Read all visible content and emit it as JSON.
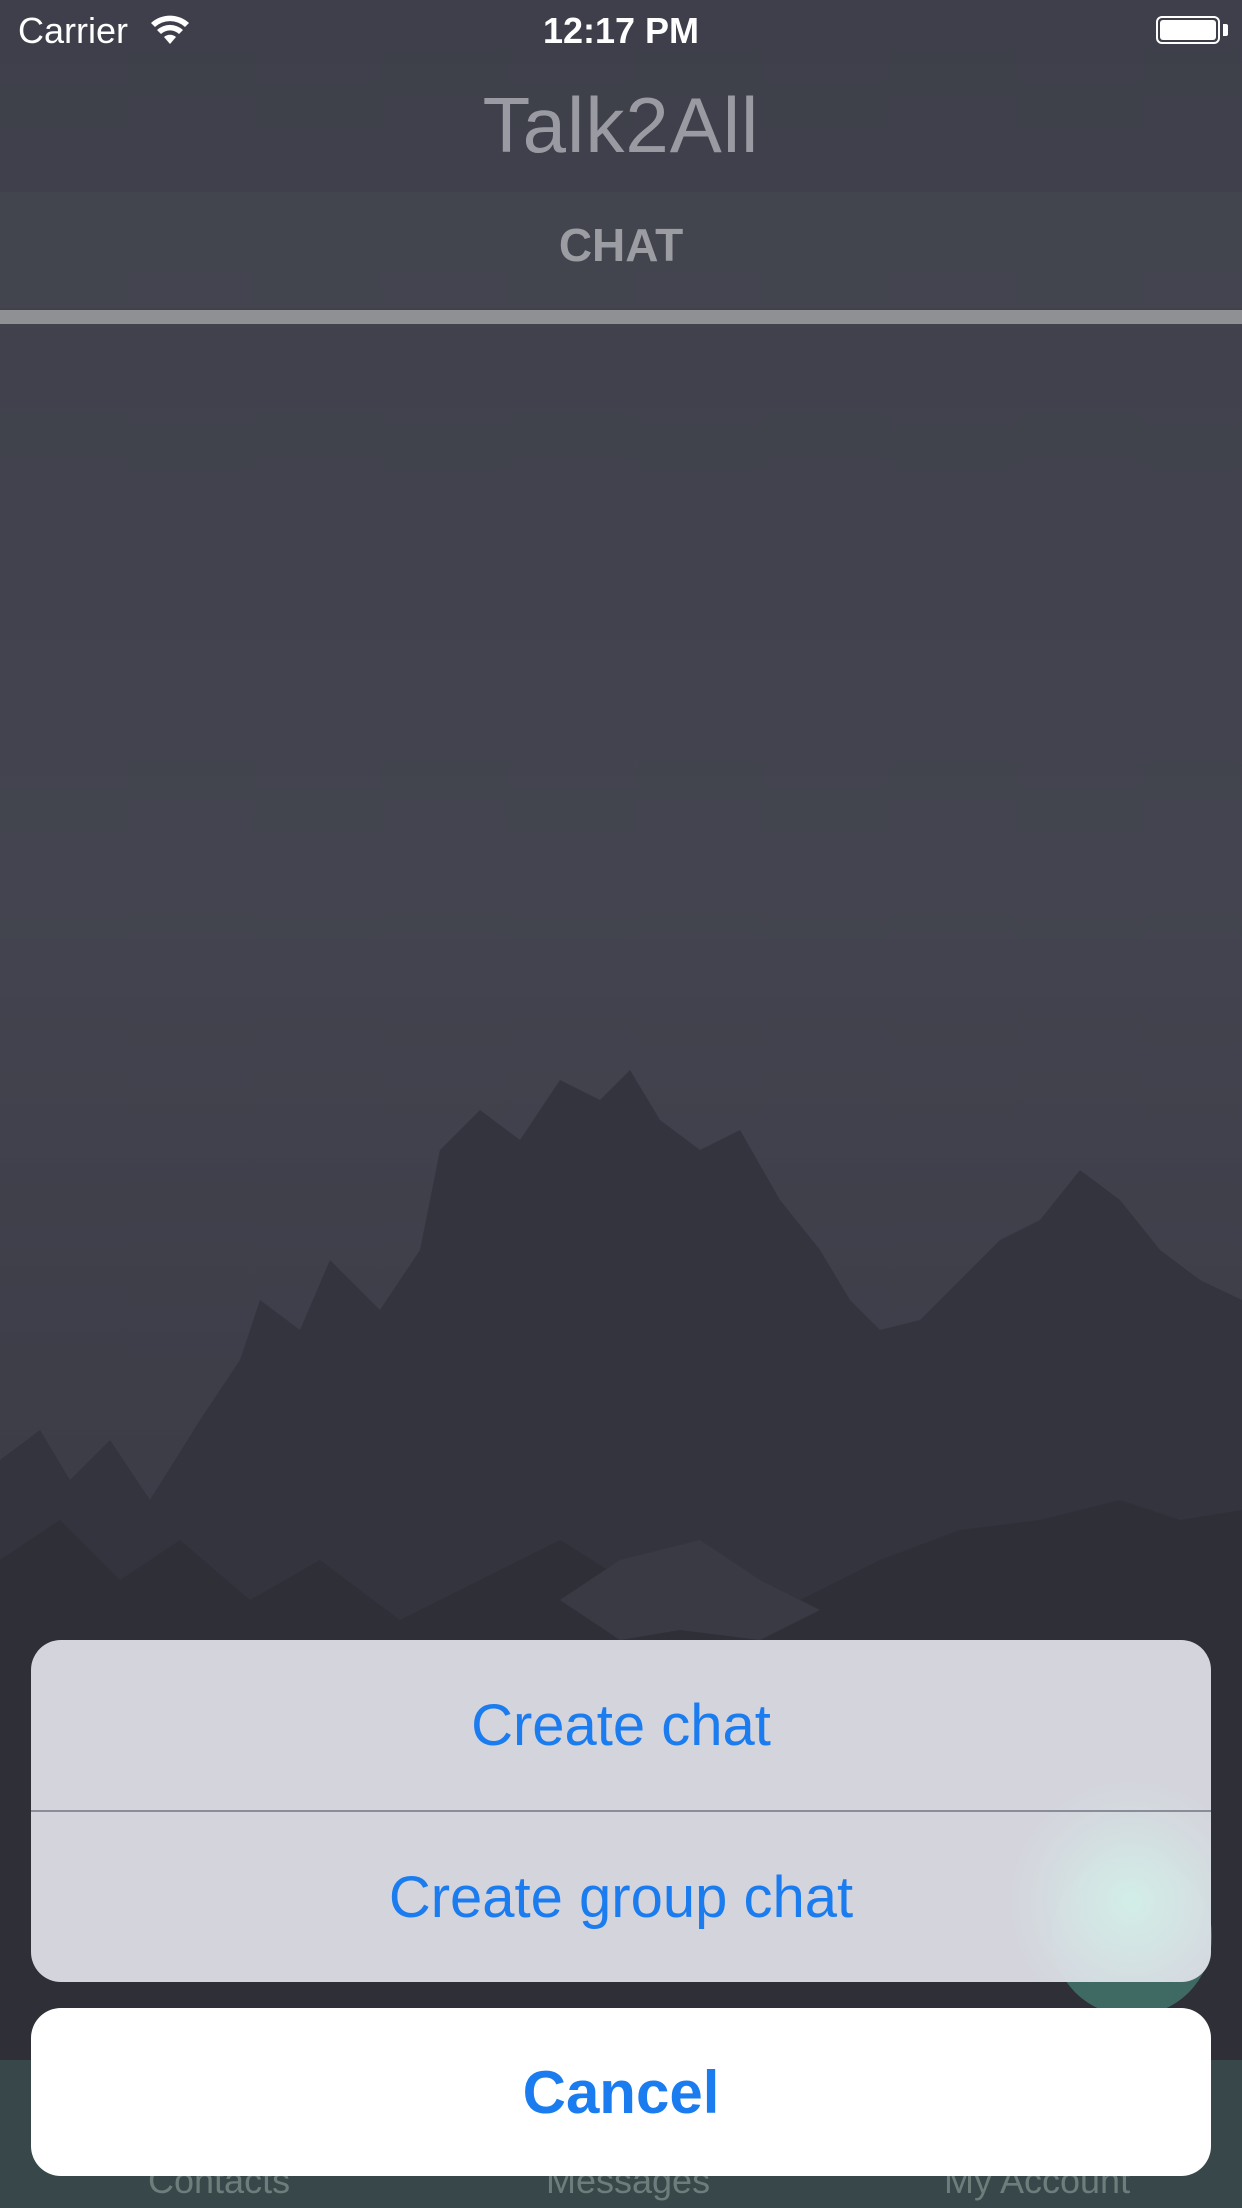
{
  "status_bar": {
    "carrier": "Carrier",
    "time": "12:17 PM"
  },
  "app": {
    "title": "Talk2All",
    "tab_label": "CHAT"
  },
  "bottom_nav": {
    "items": [
      "Contacts",
      "Messages",
      "My Account"
    ]
  },
  "action_sheet": {
    "options": [
      "Create chat",
      "Create group chat"
    ],
    "cancel_label": "Cancel"
  },
  "colors": {
    "accent": "#1b7cf0",
    "background": "#3d3e48",
    "title": "#9a9ba2"
  }
}
